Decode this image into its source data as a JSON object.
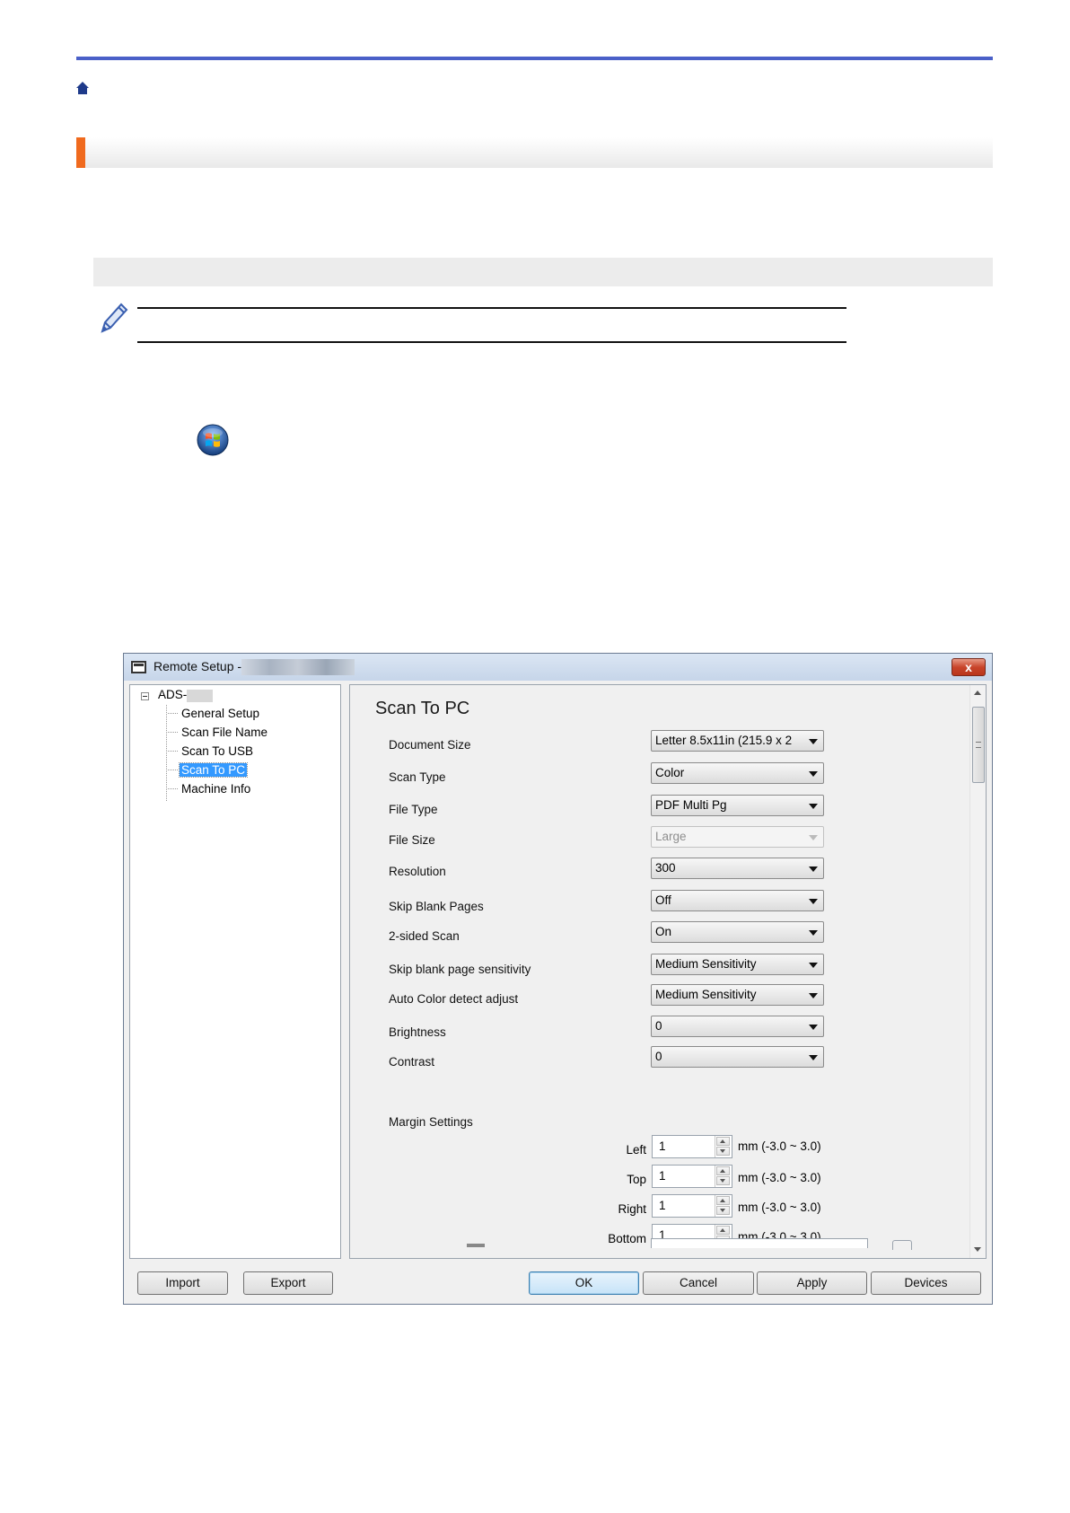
{
  "dialog": {
    "title": "Remote Setup -",
    "close_label": "x",
    "tree": {
      "root": "ADS-",
      "items": [
        "General Setup",
        "Scan File Name",
        "Scan To USB",
        "Scan To PC",
        "Machine Info"
      ],
      "selected_index": 3
    },
    "section_title": "Scan To PC",
    "fields": [
      {
        "label": "Document Size",
        "value": "Letter 8.5x11in (215.9 x 2"
      },
      {
        "label": "Scan Type",
        "value": "Color"
      },
      {
        "label": "File Type",
        "value": "PDF Multi Pg"
      },
      {
        "label": "File Size",
        "value": "Large",
        "disabled": true
      },
      {
        "label": "Resolution",
        "value": "300"
      },
      {
        "label": "Skip Blank Pages",
        "value": "Off"
      },
      {
        "label": "2-sided Scan",
        "value": "On"
      },
      {
        "label": "Skip blank page sensitivity",
        "value": "Medium Sensitivity"
      },
      {
        "label": "Auto Color detect adjust",
        "value": "Medium Sensitivity"
      },
      {
        "label": "Brightness",
        "value": "0"
      },
      {
        "label": "Contrast",
        "value": "0"
      }
    ],
    "margin": {
      "title": "Margin Settings",
      "rows": [
        {
          "label": "Left",
          "value": "1",
          "range": "mm (-3.0 ~ 3.0)"
        },
        {
          "label": "Top",
          "value": "1",
          "range": "mm (-3.0 ~ 3.0)"
        },
        {
          "label": "Right",
          "value": "1",
          "range": "mm (-3.0 ~ 3.0)"
        },
        {
          "label": "Bottom",
          "value": "1",
          "range": "mm (-3.0 ~ 3.0)"
        }
      ]
    },
    "buttons": {
      "import": "Import",
      "export": "Export",
      "ok": "OK",
      "cancel": "Cancel",
      "apply": "Apply",
      "devices": "Devices"
    }
  },
  "colors": {
    "top_rule": "#4a60c8",
    "heading_accent": "#f06a1e",
    "tree_selection": "#3399ff"
  }
}
